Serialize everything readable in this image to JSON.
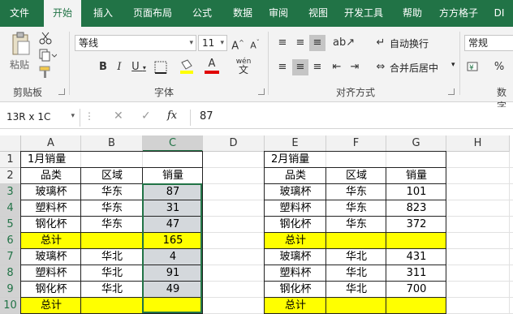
{
  "tabs": [
    "文件",
    "开始",
    "插入",
    "页面布局",
    "公式",
    "数据",
    "审阅",
    "视图",
    "开发工具",
    "帮助",
    "方方格子",
    "DI"
  ],
  "clipboard": {
    "paste_label": "粘贴",
    "group_label": "剪贴板"
  },
  "font": {
    "name": "等线",
    "size": "11",
    "group_label": "字体",
    "wen": "wén"
  },
  "alignment": {
    "wrap_label": "自动换行",
    "merge_label": "合并后居中",
    "group_label": "对齐方式"
  },
  "number": {
    "format": "常规",
    "group_label": "数字",
    "percent": "%"
  },
  "formula_bar": {
    "name_box": "13R x 1C",
    "fx": "fx",
    "value": "87"
  },
  "columns": [
    "A",
    "B",
    "C",
    "D",
    "E",
    "F",
    "G",
    "H"
  ],
  "rows": [
    "1",
    "2",
    "3",
    "4",
    "5",
    "6",
    "7",
    "8",
    "9",
    "10"
  ],
  "table1": {
    "title": "1月销量",
    "headers": [
      "品类",
      "区域",
      "销量"
    ],
    "rows": [
      [
        "玻璃杯",
        "华东",
        "87"
      ],
      [
        "塑料杯",
        "华东",
        "31"
      ],
      [
        "钢化杯",
        "华东",
        "47"
      ],
      [
        "总计",
        "",
        "165"
      ],
      [
        "玻璃杯",
        "华北",
        "4"
      ],
      [
        "塑料杯",
        "华北",
        "91"
      ],
      [
        "钢化杯",
        "华北",
        "49"
      ],
      [
        "总计",
        "",
        ""
      ]
    ]
  },
  "table2": {
    "title": "2月销量",
    "headers": [
      "品类",
      "区域",
      "销量"
    ],
    "rows": [
      [
        "玻璃杯",
        "华东",
        "101"
      ],
      [
        "塑料杯",
        "华东",
        "823"
      ],
      [
        "钢化杯",
        "华东",
        "372"
      ],
      [
        "总计",
        "",
        ""
      ],
      [
        "玻璃杯",
        "华北",
        "431"
      ],
      [
        "塑料杯",
        "华北",
        "311"
      ],
      [
        "钢化杯",
        "华北",
        "700"
      ],
      [
        "总计",
        "",
        ""
      ]
    ]
  },
  "colors": {
    "ribbon_green": "#217346",
    "total_yellow": "#ffff00",
    "selection_gray": "#d4d8dc"
  }
}
